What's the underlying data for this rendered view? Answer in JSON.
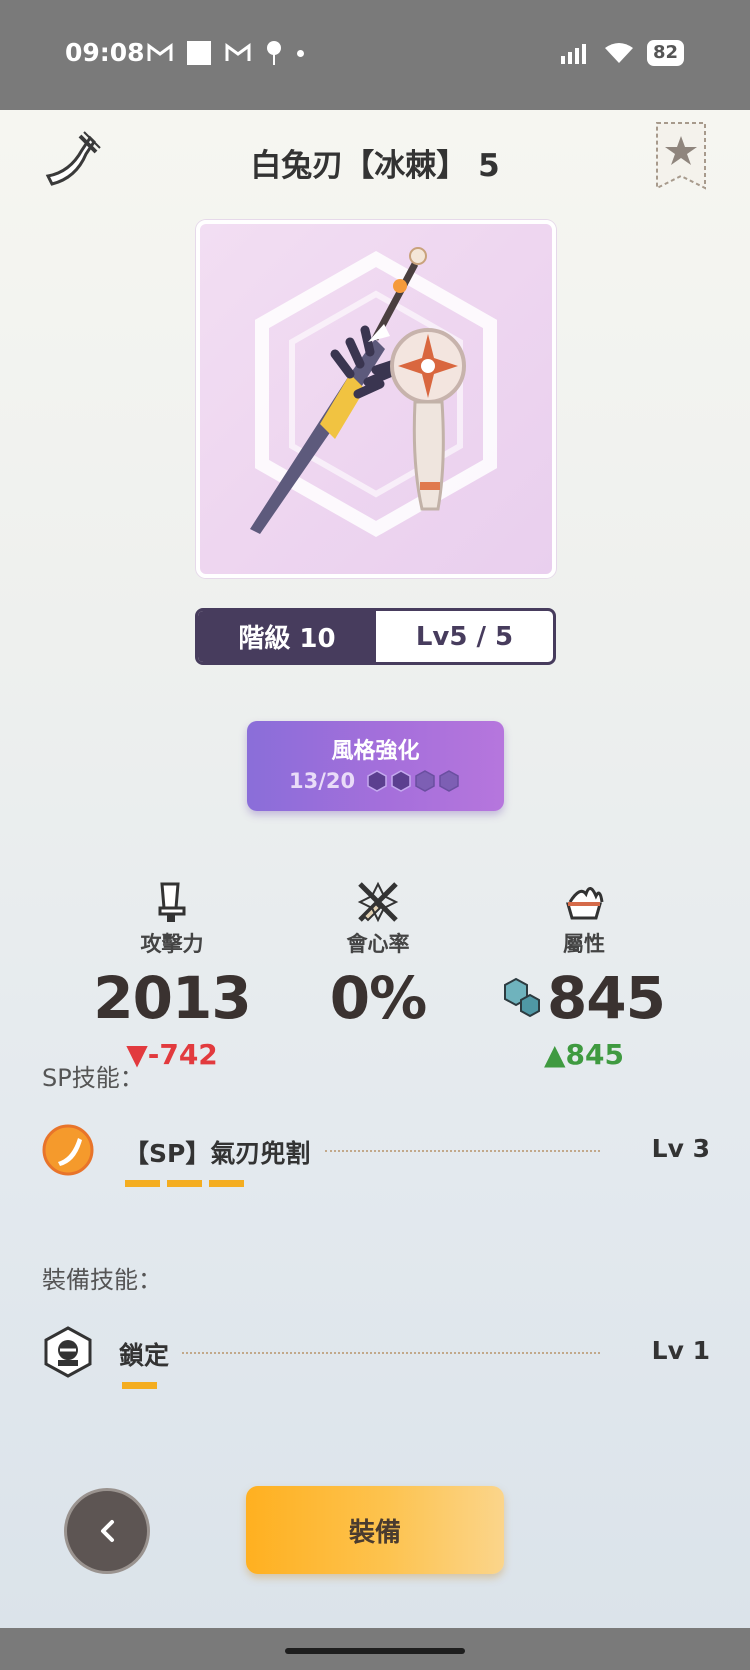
{
  "status_bar": {
    "time": "09:08",
    "battery": "82"
  },
  "header": {
    "title": "白兔刃【冰棘】 5"
  },
  "weapon": {
    "rank_label": "階級 10",
    "level_label": "Lv5 / 5"
  },
  "style_enhance": {
    "label": "風格強化",
    "progress": "13/20",
    "filled": 2,
    "total": 4
  },
  "stats": [
    {
      "label": "攻擊力",
      "value": "2013",
      "delta": "▼-742",
      "direction": "down",
      "icon": "blade-icon"
    },
    {
      "label": "會心率",
      "value": "0%",
      "delta": "",
      "direction": "none",
      "icon": "critical-icon"
    },
    {
      "label": "屬性",
      "value": "845",
      "delta": "▲845",
      "direction": "up",
      "icon": "element-icon"
    }
  ],
  "sp_skills": {
    "title": "SP技能：",
    "items": [
      {
        "name": "【SP】氣刃兜割",
        "level": "Lv 3",
        "bars": 3
      }
    ]
  },
  "equip_skills": {
    "title": "裝備技能：",
    "items": [
      {
        "name": "鎖定",
        "level": "Lv 1",
        "bars": 1
      }
    ]
  },
  "actions": {
    "equip_label": "裝備"
  },
  "colors": {
    "rank_bg": "#473c5d",
    "style_gradient_start": "#8a6ed9",
    "equip_gradient_start": "#ffb020",
    "delta_down": "#e23a3e",
    "delta_up": "#3f9a40",
    "skill_bar": "#f4ad20"
  }
}
